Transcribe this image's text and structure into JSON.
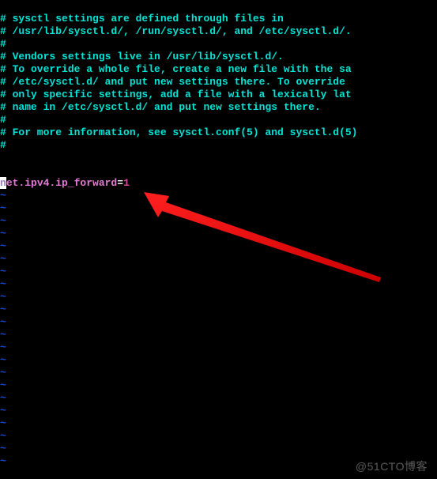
{
  "comments": {
    "l1": "# sysctl settings are defined through files in",
    "l2": "# /usr/lib/sysctl.d/, /run/sysctl.d/, and /etc/sysctl.d/.",
    "l3": "#",
    "l4": "# Vendors settings live in /usr/lib/sysctl.d/.",
    "l5": "# To override a whole file, create a new file with the sa",
    "l6": "# /etc/sysctl.d/ and put new settings there. To override ",
    "l7": "# only specific settings, add a file with a lexically lat",
    "l8": "# name in /etc/sysctl.d/ and put new settings there.",
    "l9": "#",
    "l10": "# For more information, see sysctl.conf(5) and sysctl.d(5)",
    "l11": "#"
  },
  "config": {
    "cursor_char": "n",
    "key_rest": "et.ipv4.ip_forward",
    "equals": "=",
    "value": "1"
  },
  "tilde": "~",
  "watermark": "@51CTO博客",
  "arrow": {
    "color": "#ff0000"
  }
}
